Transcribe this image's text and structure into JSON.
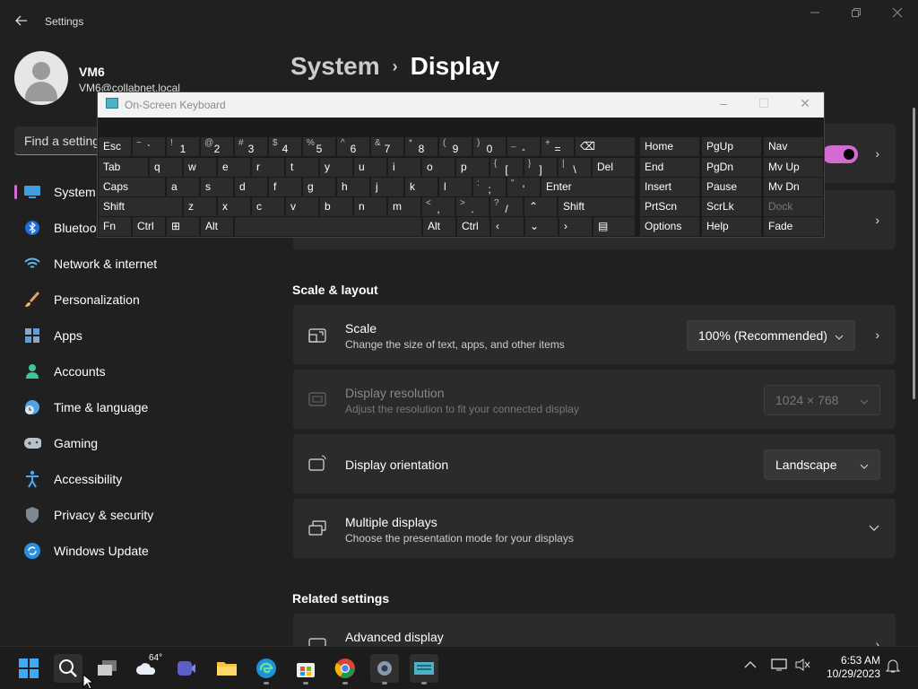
{
  "window": {
    "title": "Settings"
  },
  "user": {
    "name": "VM6",
    "email": "VM6@collabnet.local"
  },
  "search": {
    "placeholder": "Find a setting"
  },
  "nav": {
    "items": [
      {
        "label": "System",
        "icon": "monitor-icon"
      },
      {
        "label": "Bluetooth & devices",
        "icon": "bluetooth-icon"
      },
      {
        "label": "Network & internet",
        "icon": "wifi-icon"
      },
      {
        "label": "Personalization",
        "icon": "brush-icon"
      },
      {
        "label": "Apps",
        "icon": "apps-icon"
      },
      {
        "label": "Accounts",
        "icon": "person-icon"
      },
      {
        "label": "Time & language",
        "icon": "globe-clock-icon"
      },
      {
        "label": "Gaming",
        "icon": "gamepad-icon"
      },
      {
        "label": "Accessibility",
        "icon": "accessibility-icon"
      },
      {
        "label": "Privacy & security",
        "icon": "shield-icon"
      },
      {
        "label": "Windows Update",
        "icon": "update-icon"
      }
    ]
  },
  "breadcrumb": {
    "parent": "System",
    "separator": "›",
    "current": "Display"
  },
  "scale_layout": {
    "heading": "Scale & layout",
    "scale": {
      "title": "Scale",
      "subtitle": "Change the size of text, apps, and other items",
      "value": "100% (Recommended)"
    },
    "resolution": {
      "title": "Display resolution",
      "subtitle": "Adjust the resolution to fit your connected display",
      "value": "1024 × 768"
    },
    "orientation": {
      "title": "Display orientation",
      "value": "Landscape"
    },
    "multiple": {
      "title": "Multiple displays",
      "subtitle": "Choose the presentation mode for your displays"
    }
  },
  "related": {
    "heading": "Related settings",
    "advanced": {
      "title": "Advanced display"
    }
  },
  "osk": {
    "title": "On-Screen Keyboard",
    "keys": {
      "esc": "Esc",
      "tab": "Tab",
      "caps": "Caps",
      "shift": "Shift",
      "fn": "Fn",
      "ctrl": "Ctrl",
      "alt": "Alt",
      "del": "Del",
      "enter": "Enter",
      "home": "Home",
      "pgup": "PgUp",
      "nav": "Nav",
      "end": "End",
      "pgdn": "PgDn",
      "mvup": "Mv Up",
      "insert": "Insert",
      "pause": "Pause",
      "mvdn": "Mv Dn",
      "prtscn": "PrtScn",
      "scrlk": "ScrLk",
      "dock": "Dock",
      "options": "Options",
      "help": "Help",
      "fade": "Fade",
      "row1": [
        [
          "~",
          "`"
        ],
        [
          "!",
          "1"
        ],
        [
          "@",
          "2"
        ],
        [
          "#",
          "3"
        ],
        [
          "$",
          "4"
        ],
        [
          "%",
          "5"
        ],
        [
          "^",
          "6"
        ],
        [
          "&",
          "7"
        ],
        [
          "*",
          "8"
        ],
        [
          "(",
          "9"
        ],
        [
          ")",
          "0"
        ],
        [
          "_",
          "-"
        ],
        [
          "+",
          "="
        ]
      ],
      "row2": [
        "q",
        "w",
        "e",
        "r",
        "t",
        "y",
        "u",
        "i",
        "o",
        "p"
      ],
      "row2b": [
        [
          "{",
          "["
        ],
        [
          "}",
          "]"
        ],
        [
          "|",
          "\\"
        ]
      ],
      "row3": [
        "a",
        "s",
        "d",
        "f",
        "g",
        "h",
        "j",
        "k",
        "l"
      ],
      "row3b": [
        [
          ":",
          ";"
        ],
        [
          "\"",
          "'"
        ]
      ],
      "row4": [
        "z",
        "x",
        "c",
        "v",
        "b",
        "n",
        "m"
      ],
      "row4b": [
        [
          "<",
          ","
        ],
        [
          ">",
          "."
        ],
        [
          "?",
          "/"
        ]
      ]
    }
  },
  "taskbar": {
    "weather": "64°",
    "time": "6:53 AM",
    "date": "10/29/2023"
  }
}
